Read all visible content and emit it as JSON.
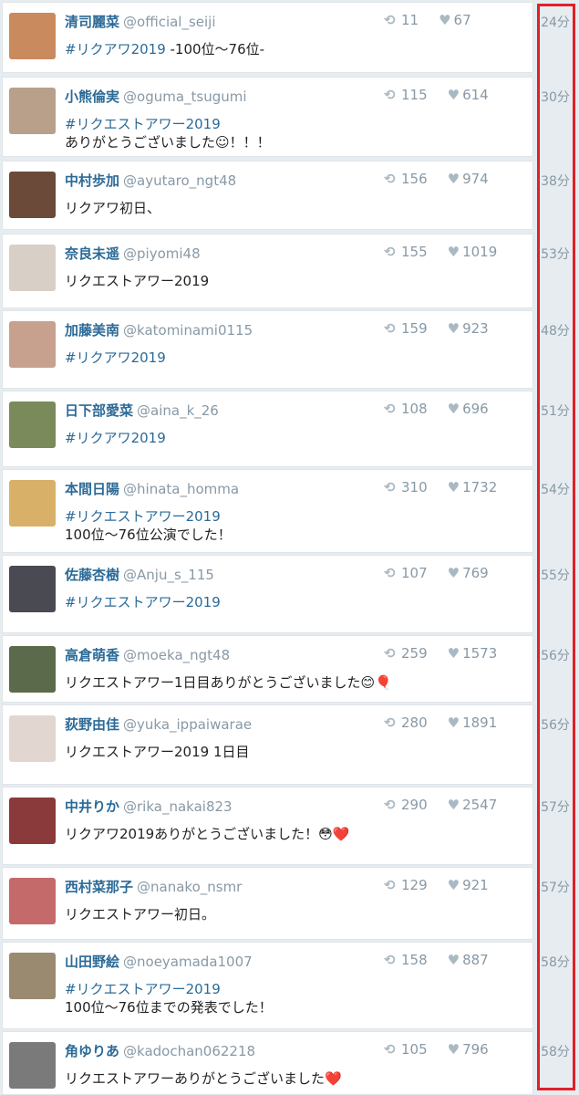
{
  "tweets": [
    {
      "name": "清司麗菜",
      "handle": "@official_seiji",
      "retweets": "11",
      "likes": "67",
      "time": "24分",
      "lines": [
        [
          {
            "t": "#リクアワ2019",
            "c": "hashtag"
          },
          {
            "t": " -100位〜76位-"
          }
        ]
      ],
      "avatar_color": "#c98a5e"
    },
    {
      "name": "小熊倫実",
      "handle": "@oguma_tsugumi",
      "retweets": "115",
      "likes": "614",
      "time": "30分",
      "lines": [
        [
          {
            "t": "#リクエストアワー2019",
            "c": "hashtag"
          }
        ],
        [
          {
            "t": "ありがとうございました☺！！！"
          }
        ]
      ],
      "avatar_color": "#b9a08a"
    },
    {
      "name": "中村歩加",
      "handle": "@ayutaro_ngt48",
      "retweets": "156",
      "likes": "974",
      "time": "38分",
      "lines": [
        [
          {
            "t": "リクアワ初日、"
          }
        ]
      ],
      "avatar_color": "#6b4a3a"
    },
    {
      "name": "奈良未遥",
      "handle": "@piyomi48",
      "retweets": "155",
      "likes": "1019",
      "time": "53分",
      "lines": [
        [
          {
            "t": "リクエストアワー2019"
          }
        ]
      ],
      "avatar_color": "#d8cfc6"
    },
    {
      "name": "加藤美南",
      "handle": "@katominami0115",
      "retweets": "159",
      "likes": "923",
      "time": "48分",
      "lines": [
        [
          {
            "t": "#リクアワ2019",
            "c": "hashtag"
          }
        ]
      ],
      "avatar_color": "#c7a08e"
    },
    {
      "name": "日下部愛菜",
      "handle": "@aina_k_26",
      "retweets": "108",
      "likes": "696",
      "time": "51分",
      "lines": [
        [
          {
            "t": "#リクアワ2019",
            "c": "hashtag"
          }
        ]
      ],
      "avatar_color": "#7a8a5a"
    },
    {
      "name": "本間日陽",
      "handle": "@hinata_homma",
      "retweets": "310",
      "likes": "1732",
      "time": "54分",
      "lines": [
        [
          {
            "t": "#リクエストアワー2019",
            "c": "hashtag"
          }
        ],
        [
          {
            "t": "100位〜76位公演でした！"
          }
        ]
      ],
      "avatar_color": "#d9b068"
    },
    {
      "name": "佐藤杏樹",
      "handle": "@Anju_s_115",
      "retweets": "107",
      "likes": "769",
      "time": "55分",
      "lines": [
        [
          {
            "t": "#リクエストアワー2019",
            "c": "hashtag"
          }
        ]
      ],
      "avatar_color": "#4a4a52"
    },
    {
      "name": "高倉萌香",
      "handle": "@moeka_ngt48",
      "retweets": "259",
      "likes": "1573",
      "time": "56分",
      "lines": [
        [
          {
            "t": "リクエストアワー1日目ありがとうございました😊🎈"
          }
        ]
      ],
      "avatar_color": "#5b6a4a"
    },
    {
      "name": "荻野由佳",
      "handle": "@yuka_ippaiwarae",
      "retweets": "280",
      "likes": "1891",
      "time": "56分",
      "lines": [
        [
          {
            "t": "リクエストアワー2019 1日目"
          }
        ]
      ],
      "avatar_color": "#e2d6d0"
    },
    {
      "name": "中井りか",
      "handle": "@rika_nakai823",
      "retweets": "290",
      "likes": "2547",
      "time": "57分",
      "lines": [
        [
          {
            "t": "リクアワ2019ありがとうございました！😳❤️"
          }
        ]
      ],
      "avatar_color": "#8a3a3a"
    },
    {
      "name": "西村菜那子",
      "handle": "@nanako_nsmr",
      "retweets": "129",
      "likes": "921",
      "time": "57分",
      "lines": [
        [
          {
            "t": "リクエストアワー初日。"
          }
        ]
      ],
      "avatar_color": "#c46a6a"
    },
    {
      "name": "山田野絵",
      "handle": "@noeyamada1007",
      "retweets": "158",
      "likes": "887",
      "time": "58分",
      "lines": [
        [
          {
            "t": "#リクエストアワー2019",
            "c": "hashtag"
          }
        ],
        [
          {
            "t": "100位〜76位までの発表でした！"
          }
        ]
      ],
      "avatar_color": "#9a8a70"
    },
    {
      "name": "角ゆりあ",
      "handle": "@kadochan062218",
      "retweets": "105",
      "likes": "796",
      "time": "58分",
      "lines": [
        [
          {
            "t": "リクエストアワーありがとうございました❤️"
          }
        ]
      ],
      "avatar_color": "#7a7a7a"
    }
  ],
  "icons": {
    "retweet": "retweet-icon",
    "like": "heart-icon"
  },
  "colors": {
    "highlight": "#e0202a",
    "link": "#2b6a97",
    "muted": "#8899a6"
  }
}
